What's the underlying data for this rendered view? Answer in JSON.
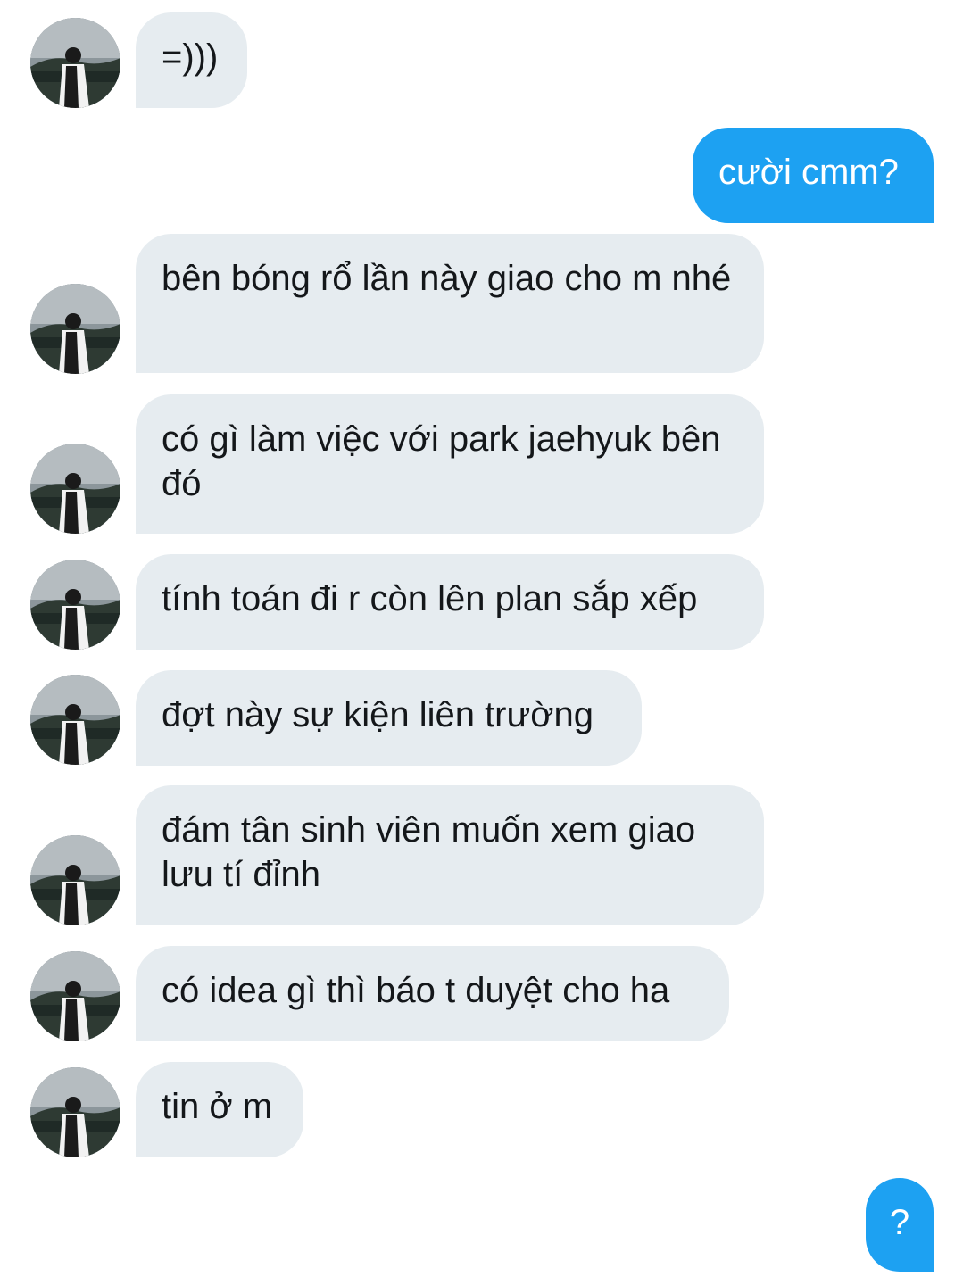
{
  "conversation": {
    "messages": [
      {
        "from": "them",
        "text": "=)))"
      },
      {
        "from": "me",
        "text": "cười cmm?"
      },
      {
        "from": "them",
        "text": "bên bóng rổ lần này giao cho m nhé"
      },
      {
        "from": "them",
        "text": "có gì làm việc với park jaehyuk bên đó"
      },
      {
        "from": "them",
        "text": "tính toán đi r còn lên plan sắp xếp"
      },
      {
        "from": "them",
        "text": "đợt này sự kiện liên trường"
      },
      {
        "from": "them",
        "text": "đám tân sinh viên muốn xem giao lưu tí đỉnh"
      },
      {
        "from": "them",
        "text": "có idea gì thì báo t duyệt cho ha"
      },
      {
        "from": "them",
        "text": "tin ở m"
      },
      {
        "from": "me",
        "text": "?"
      }
    ]
  },
  "colors": {
    "incoming_bubble": "#e6ecf0",
    "outgoing_bubble": "#1da1f2",
    "incoming_text": "#14171a",
    "outgoing_text": "#ffffff"
  },
  "icons": {
    "avatar": "profile-photo-avatar"
  }
}
